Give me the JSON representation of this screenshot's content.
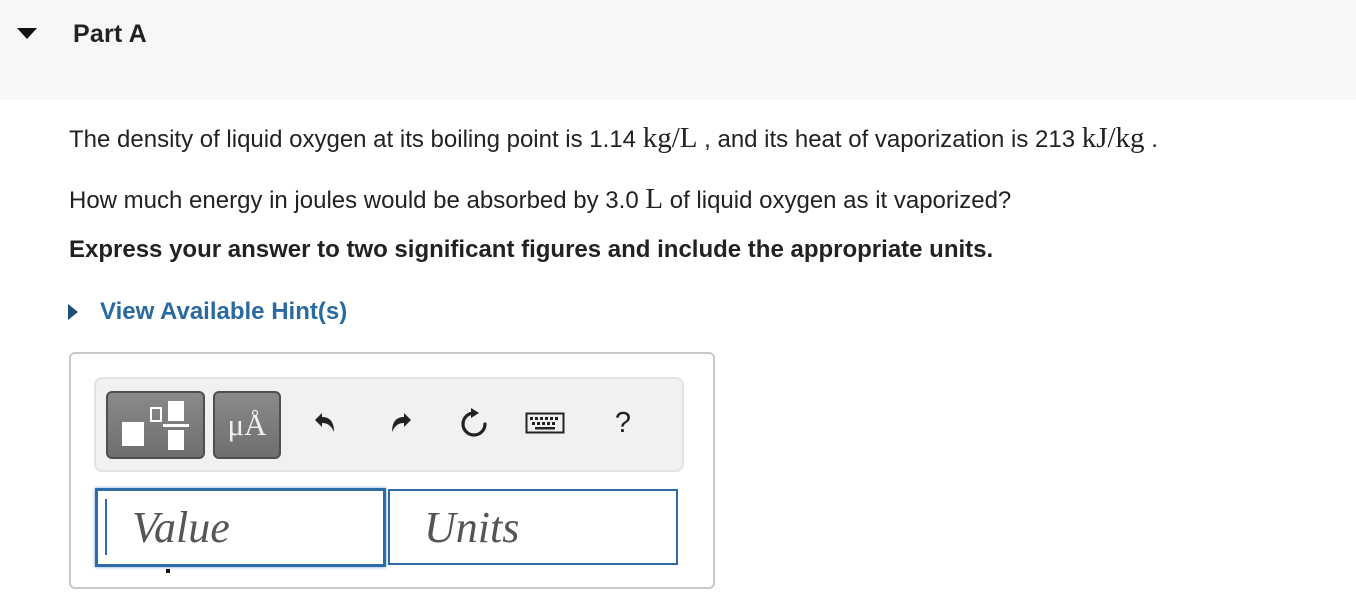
{
  "header": {
    "part_title": "Part A"
  },
  "problem": {
    "text_1": "The density of liquid oxygen at its boiling point is 1.14 ",
    "density_unit": "kg/L",
    "text_2": " , and its heat of vaporization is 213 ",
    "heat_unit": "kJ/kg",
    "text_3": " ."
  },
  "question": {
    "text_1": "How much energy in joules would be absorbed by 3.0 ",
    "volume_unit": "L",
    "text_2": " of liquid oxygen as it vaporized?"
  },
  "instruction": "Express your answer to two significant figures and include the appropriate units.",
  "hint": {
    "label": "View Available Hint(s)"
  },
  "answer": {
    "toolbar": {
      "units_button": "μÅ",
      "help_button": "?"
    },
    "value_placeholder": "Value",
    "units_placeholder": "Units"
  },
  "colors": {
    "link": "#2a6aa0",
    "input_border": "#2e6ca8",
    "header_bg": "#f7f7f7"
  }
}
